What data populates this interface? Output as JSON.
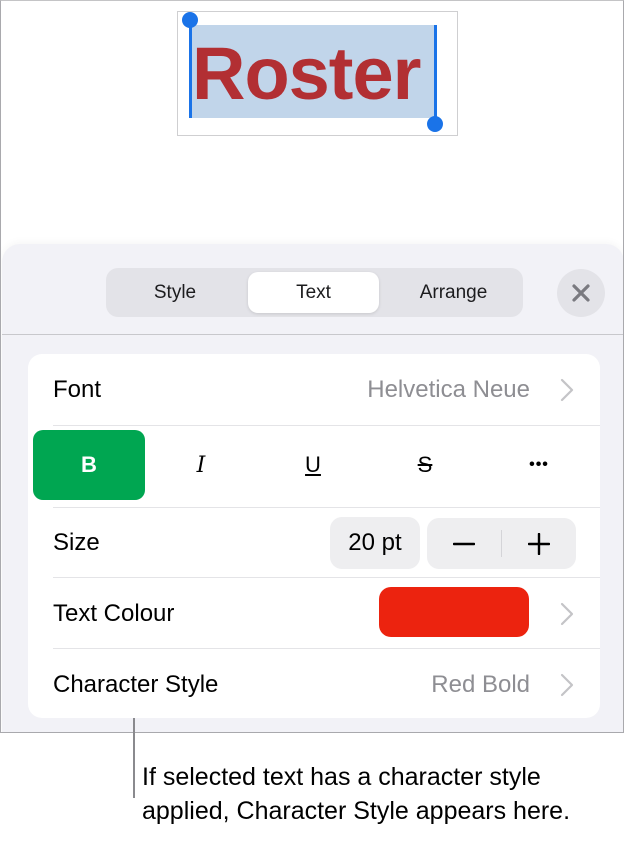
{
  "canvas": {
    "selected_text": "Roster",
    "text_color": "#b22f33",
    "selection_color": "#c1d5ea",
    "handle_color": "#1a73e8"
  },
  "panel": {
    "tabs": [
      {
        "label": "Style",
        "selected": false
      },
      {
        "label": "Text",
        "selected": true
      },
      {
        "label": "Arrange",
        "selected": false
      }
    ],
    "close_icon": "close-icon"
  },
  "text_settings": {
    "font": {
      "label": "Font",
      "value": "Helvetica Neue"
    },
    "format_buttons": [
      {
        "label": "B",
        "name": "bold",
        "active": true
      },
      {
        "label": "I",
        "name": "italic",
        "active": false
      },
      {
        "label": "U",
        "name": "underline",
        "active": false
      },
      {
        "label": "S",
        "name": "strikethrough",
        "active": false
      },
      {
        "label": "•••",
        "name": "more",
        "active": false
      }
    ],
    "active_color": "#00a651",
    "size": {
      "label": "Size",
      "value": "20 pt",
      "decrement": "−",
      "increment": "+"
    },
    "text_colour": {
      "label": "Text Colour",
      "swatch": "#ec230f"
    },
    "character_style": {
      "label": "Character Style",
      "value": "Red Bold"
    }
  },
  "callout": {
    "text": "If selected text has a character style applied, Character Style appears here."
  }
}
